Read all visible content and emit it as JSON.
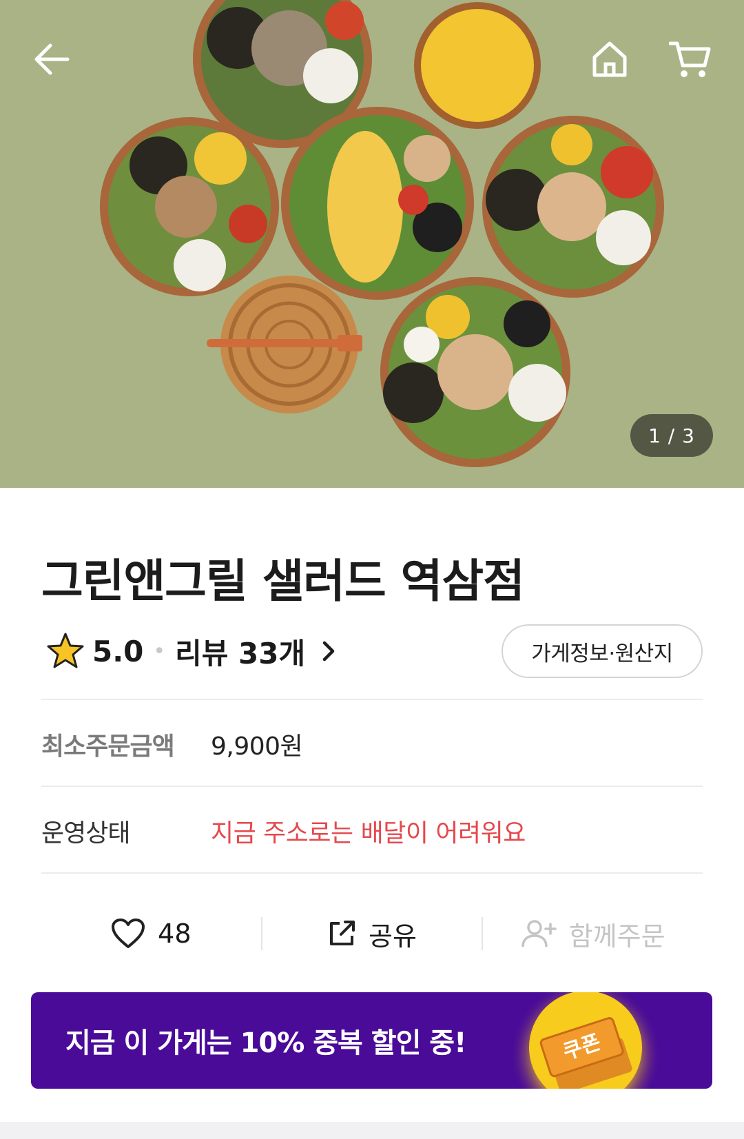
{
  "hero": {
    "image_counter": "1 / 3",
    "back_icon": "arrow-left-icon",
    "home_icon": "home-icon",
    "cart_icon": "cart-icon"
  },
  "store": {
    "name": "그린앤그릴 샐러드 역삼점",
    "rating": "5.0",
    "review_label": "리뷰 33개",
    "info_button": "가게정보·원산지"
  },
  "details": {
    "min_order_label": "최소주문금액",
    "min_order_value": "9,900원",
    "status_label": "운영상태",
    "status_value": "지금 주소로는 배달이 어려워요",
    "status_color": "#e5484d"
  },
  "actions": {
    "like_count": "48",
    "share_label": "공유",
    "group_order_label": "함께주문"
  },
  "banner": {
    "text": "지금 이 가게는 10% 중복 할인 중!",
    "coupon_label": "쿠폰",
    "background": "#4a0b98"
  }
}
